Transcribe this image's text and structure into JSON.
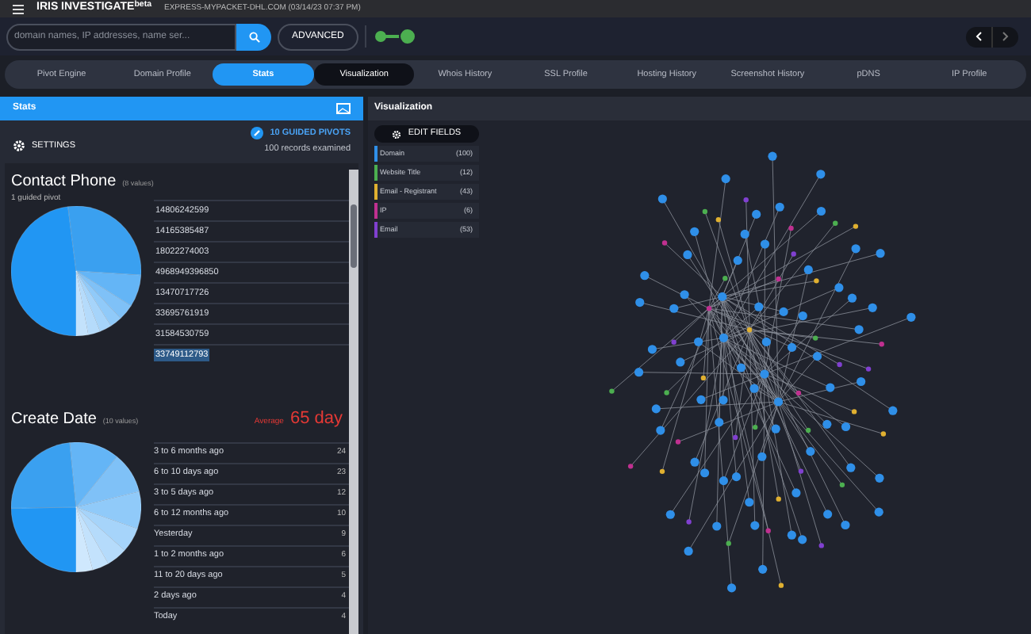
{
  "app": {
    "title": "IRIS INVESTIGATE$^{beta}$",
    "context": "EXPRESS-MYPACKET-DHL.COM (03/14/23 07:37 PM)"
  },
  "search": {
    "placeholder": "domain names, IP addresses, name ser...",
    "advanced": "ADVANCED",
    "toggle_on": true
  },
  "tabs": [
    {
      "label": "Pivot Engine",
      "selected": false,
      "highlighted": false
    },
    {
      "label": "Domain Profile",
      "selected": false,
      "highlighted": false
    },
    {
      "label": "Stats",
      "selected": true,
      "highlighted": false
    },
    {
      "label": "Visualization",
      "selected": false,
      "highlighted": true
    },
    {
      "label": "Whois History",
      "selected": false,
      "highlighted": false
    },
    {
      "label": "SSL Profile",
      "selected": false,
      "highlighted": false
    },
    {
      "label": "Hosting History",
      "selected": false,
      "highlighted": false
    },
    {
      "label": "Screenshot History",
      "selected": false,
      "highlighted": false
    },
    {
      "label": "pDNS",
      "selected": false,
      "highlighted": false
    },
    {
      "label": "IP Profile",
      "selected": false,
      "highlighted": false
    }
  ],
  "stats": {
    "title": "Stats",
    "settings": "SETTINGS",
    "guided_pivots": "10 GUIDED PIVOTS",
    "records": "100 records examined",
    "contact_phone": {
      "title": "Contact Phone",
      "values": "(8 values)",
      "subtitle": "1 guided pivot",
      "rows": [
        {
          "value": "14806242599",
          "selected": false
        },
        {
          "value": "14165385487",
          "selected": false
        },
        {
          "value": "18022274003",
          "selected": false
        },
        {
          "value": "4968949396850",
          "selected": false
        },
        {
          "value": "13470717726",
          "selected": false
        },
        {
          "value": "33695761919",
          "selected": false
        },
        {
          "value": "31584530759",
          "selected": false
        },
        {
          "value": "33749112793",
          "selected": true
        }
      ]
    },
    "create_date": {
      "title": "Create Date",
      "values": "(10 values)",
      "average_label": "Average",
      "average_value": "65 day",
      "rows": [
        {
          "label": "3 to 6 months ago",
          "count": "24"
        },
        {
          "label": "6 to 10 days ago",
          "count": "23"
        },
        {
          "label": "3 to 5 days ago",
          "count": "12"
        },
        {
          "label": "6 to 12 months ago",
          "count": "10"
        },
        {
          "label": "Yesterday",
          "count": "9"
        },
        {
          "label": "1 to 2 months ago",
          "count": "6"
        },
        {
          "label": "11 to 20 days ago",
          "count": "5"
        },
        {
          "label": "2 days ago",
          "count": "4"
        },
        {
          "label": "Today",
          "count": "4"
        }
      ]
    }
  },
  "visualization": {
    "title": "Visualization",
    "edit_fields": "EDIT FIELDS",
    "legend": [
      {
        "label": "Domain",
        "count": "(100)",
        "color": "#2f8fe8"
      },
      {
        "label": "Website Title",
        "count": "(12)",
        "color": "#4caf50"
      },
      {
        "label": "Email - Registrant",
        "count": "(43)",
        "color": "#e0b030"
      },
      {
        "label": "IP",
        "count": "(6)",
        "color": "#c03090"
      },
      {
        "label": "Email",
        "count": "(53)",
        "color": "#8040d0"
      }
    ]
  }
}
